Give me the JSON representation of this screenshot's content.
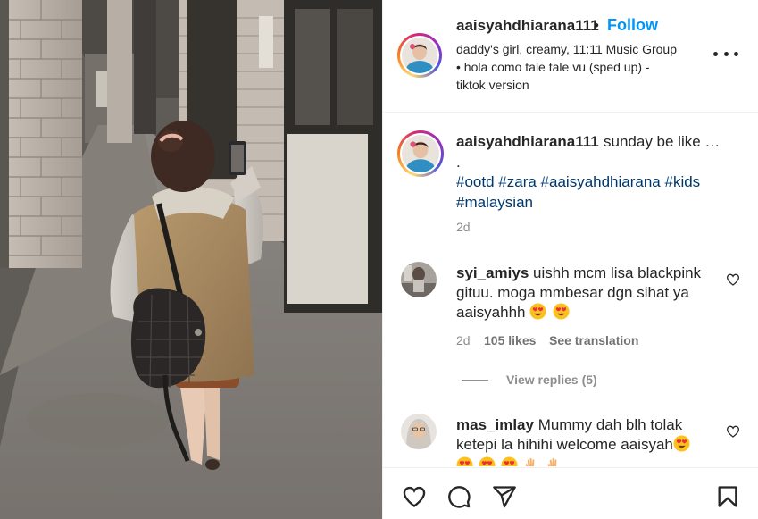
{
  "post": {
    "username": "aaisyahdhiarana111",
    "separator": "•",
    "follow_label": "Follow",
    "audio": "daddy's girl, creamy, 11:11 Music Group • hola como tale tale vu (sped up) - tiktok version"
  },
  "caption": {
    "username": "aaisyahdhiarana111",
    "text": "sunday be like …",
    "dot": ".",
    "hashtags": [
      "#ootd",
      "#zara",
      "#aaisyahdhiarana",
      "#kids",
      "#malaysian"
    ],
    "time": "2d"
  },
  "comments": [
    {
      "username": "syi_amiys",
      "text": "uishh mcm lisa blackpink gituu. moga mmbesar dgn sihat ya aaisyahhh",
      "emojis": [
        "heart-eyes",
        "heart-eyes"
      ],
      "time": "2d",
      "likes": "105 likes",
      "translate": "See translation",
      "replies": "View replies (5)"
    },
    {
      "username": "mas_imlay",
      "text": "Mummy dah blh tolak ketepi la hihihi welcome aaisyah",
      "emojis": [
        "heart-eyes"
      ],
      "trailing_emojis": [
        "heart-eyes",
        "heart-eyes",
        "heart-eyes",
        "clapping-hands",
        "clapping-hands"
      ]
    }
  ],
  "icons": {
    "more": "more-options-icon",
    "like": "heart-icon",
    "comment": "comment-icon",
    "share": "paper-plane-icon",
    "save": "bookmark-icon"
  },
  "colors": {
    "follow": "#0095f6",
    "hashtag": "#00376b",
    "secondary": "#8e8e8e",
    "text": "#262626"
  }
}
